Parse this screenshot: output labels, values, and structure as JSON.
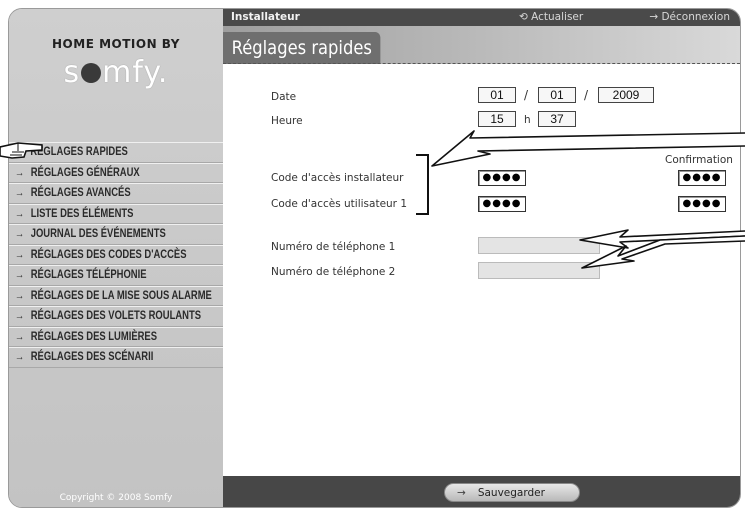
{
  "brand": {
    "top": "HOME MOTION BY",
    "logo_pre": "s",
    "logo_post": "mfy",
    "logo_mark": "."
  },
  "topbar": {
    "title": "Installateur",
    "refresh_label": "Actualiser",
    "logout_label": "Déconnexion"
  },
  "page_title": "Réglages rapides",
  "sidebar": {
    "items": [
      {
        "label": "RÉGLAGES RAPIDES",
        "icon": "hand-pointer-icon"
      },
      {
        "label": "RÉGLAGES GÉNÉRAUX",
        "icon": "arrow-right-icon"
      },
      {
        "label": "RÉGLAGES AVANCÉS",
        "icon": "arrow-right-icon"
      },
      {
        "label": "LISTE DES ÉLÉMENTS",
        "icon": "arrow-right-icon"
      },
      {
        "label": "JOURNAL DES ÉVÉNEMENTS",
        "icon": "arrow-right-icon"
      },
      {
        "label": "RÉGLAGES DES CODES D'ACCÈS",
        "icon": "arrow-right-icon"
      },
      {
        "label": "RÉGLAGES TÉLÉPHONIE",
        "icon": "arrow-right-icon"
      },
      {
        "label": "RÉGLAGES DE LA MISE SOUS ALARME",
        "icon": "arrow-right-icon"
      },
      {
        "label": "RÉGLAGES DES VOLETS ROULANTS",
        "icon": "arrow-right-icon"
      },
      {
        "label": "RÉGLAGES DES LUMIÈRES",
        "icon": "arrow-right-icon"
      },
      {
        "label": "RÉGLAGES DES SCÉNARII",
        "icon": "arrow-right-icon"
      }
    ],
    "copyright": "Copyright © 2008 Somfy"
  },
  "form": {
    "date_label": "Date",
    "date_day": "01",
    "date_month": "01",
    "date_year": "2009",
    "date_sep": "/",
    "time_label": "Heure",
    "time_hour": "15",
    "time_sep": "h",
    "time_minute": "37",
    "confirmation_label": "Confirmation",
    "code_installer_label": "Code d'accès installateur",
    "code_user1_label": "Code d'accès utilisateur 1",
    "code_installer_value": "●●●●",
    "code_installer_confirm": "●●●●",
    "code_user1_value": "●●●●",
    "code_user1_confirm": "●●●●",
    "phone1_label": "Numéro de téléphone 1",
    "phone2_label": "Numéro de téléphone 2",
    "phone1_value": "",
    "phone2_value": ""
  },
  "footer": {
    "save_label": "Sauvegarder"
  }
}
